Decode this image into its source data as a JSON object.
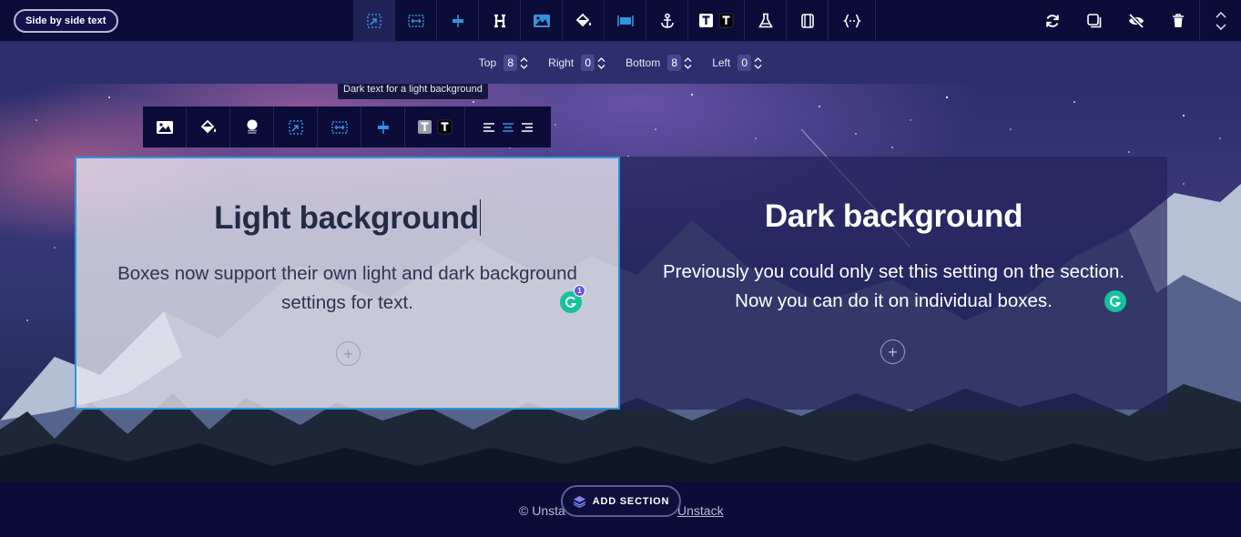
{
  "toolbar": {
    "section_name": "Side by side text",
    "tools": [
      {
        "icon": "padding-icon",
        "active": true
      },
      {
        "icon": "width-icon"
      },
      {
        "icon": "align-center-icon"
      },
      {
        "icon": "heading-icon"
      },
      {
        "icon": "image-icon"
      },
      {
        "icon": "fill-icon"
      },
      {
        "icon": "full-width-icon"
      },
      {
        "icon": "anchor-icon"
      },
      {
        "icon": "text-light-dark-icon"
      },
      {
        "icon": "flask-icon"
      },
      {
        "icon": "container-icon"
      },
      {
        "icon": "code-icon"
      }
    ],
    "right_tools": [
      "refresh-icon",
      "duplicate-icon",
      "hide-icon",
      "delete-icon",
      "move-updown-icon"
    ]
  },
  "padding": {
    "top_label": "Top",
    "top_value": "8",
    "right_label": "Right",
    "right_value": "0",
    "bottom_label": "Bottom",
    "bottom_value": "8",
    "left_label": "Left",
    "left_value": "0"
  },
  "tooltip": "Dark text for a light background",
  "box_toolbar": {
    "tools": [
      "image-icon",
      "fill-icon",
      "opacity-icon",
      "padding-icon",
      "width-icon",
      "align-center-icon",
      "text-light-dark-icon",
      "text-align-icon"
    ]
  },
  "boxes": {
    "light": {
      "title": "Light background",
      "text": "Boxes now support their own light and dark background settings for text.",
      "plus": "+",
      "grammarly_count": "1"
    },
    "dark": {
      "title": "Dark background",
      "text": "Previously you could only set this setting on the section. Now you can do it on individual boxes.",
      "plus": "+"
    }
  },
  "footer": {
    "copyright": "© Unsta",
    "link": "Unstack",
    "add_section": "ADD SECTION"
  },
  "colors": {
    "accent": "#2f93dd",
    "toolbar_bg": "#0b0c38",
    "padbar_bg": "#2c2e6e",
    "grammarly": "#15c39a"
  }
}
